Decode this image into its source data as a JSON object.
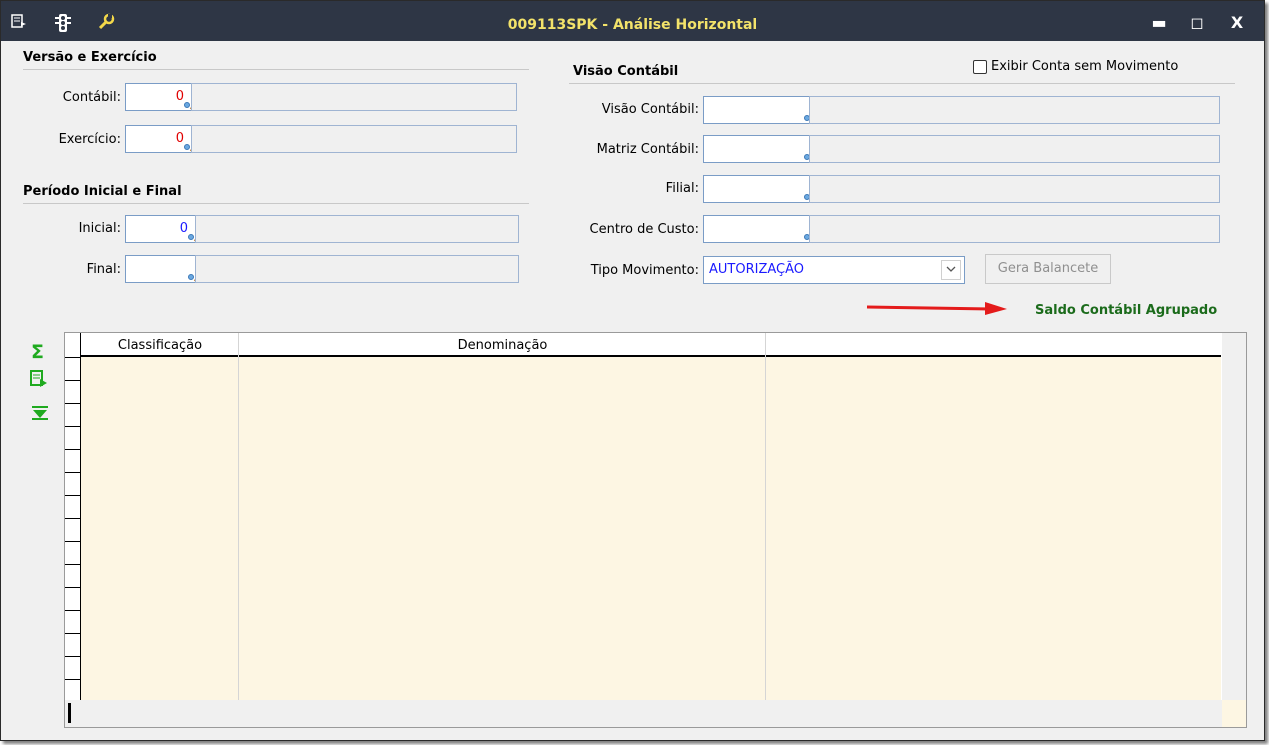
{
  "window": {
    "title": "009113SPK - Análise Horizontal",
    "title_icons": [
      "menu-icon",
      "traffic-light-icon",
      "wrench-icon"
    ],
    "controls": [
      "minimize",
      "maximize",
      "close"
    ],
    "controls_glyphs": [
      "▬",
      "◻",
      "X"
    ]
  },
  "versao": {
    "heading": "Versão e Exercício",
    "contabil_label": "Contábil:",
    "contabil_value": "0",
    "exercicio_label": "Exercício:",
    "exercicio_value": "0"
  },
  "periodo": {
    "heading": "Período Inicial e Final",
    "inicial_label": "Inicial:",
    "inicial_value": "0",
    "final_label": "Final:",
    "final_value": ""
  },
  "visao": {
    "heading": "Visão Contábil",
    "exibir_label": "Exibir Conta sem Movimento",
    "visao_label": "Visão Contábil:",
    "matriz_label": "Matriz Contábil:",
    "filial_label": "Filial:",
    "centro_label": "Centro de Custo:",
    "tipo_label": "Tipo Movimento:",
    "tipo_value": "AUTORIZAÇÃO",
    "gera_button": "Gera Balancete",
    "saldo_link": "Saldo Contábil Agrupado"
  },
  "grid": {
    "columns": [
      "Classificação",
      "Denominação"
    ],
    "side_icons": [
      "sum-icon",
      "export-icon",
      "expand-icon"
    ]
  },
  "colors": {
    "title_bg": "#2e3645",
    "title_text": "#f3e36a",
    "red_value": "#e00000",
    "blue_value": "#1a1aff",
    "green_text": "#1b6b1b",
    "arrow": "#e41b1b",
    "grid_body": "#fdf6e3"
  }
}
